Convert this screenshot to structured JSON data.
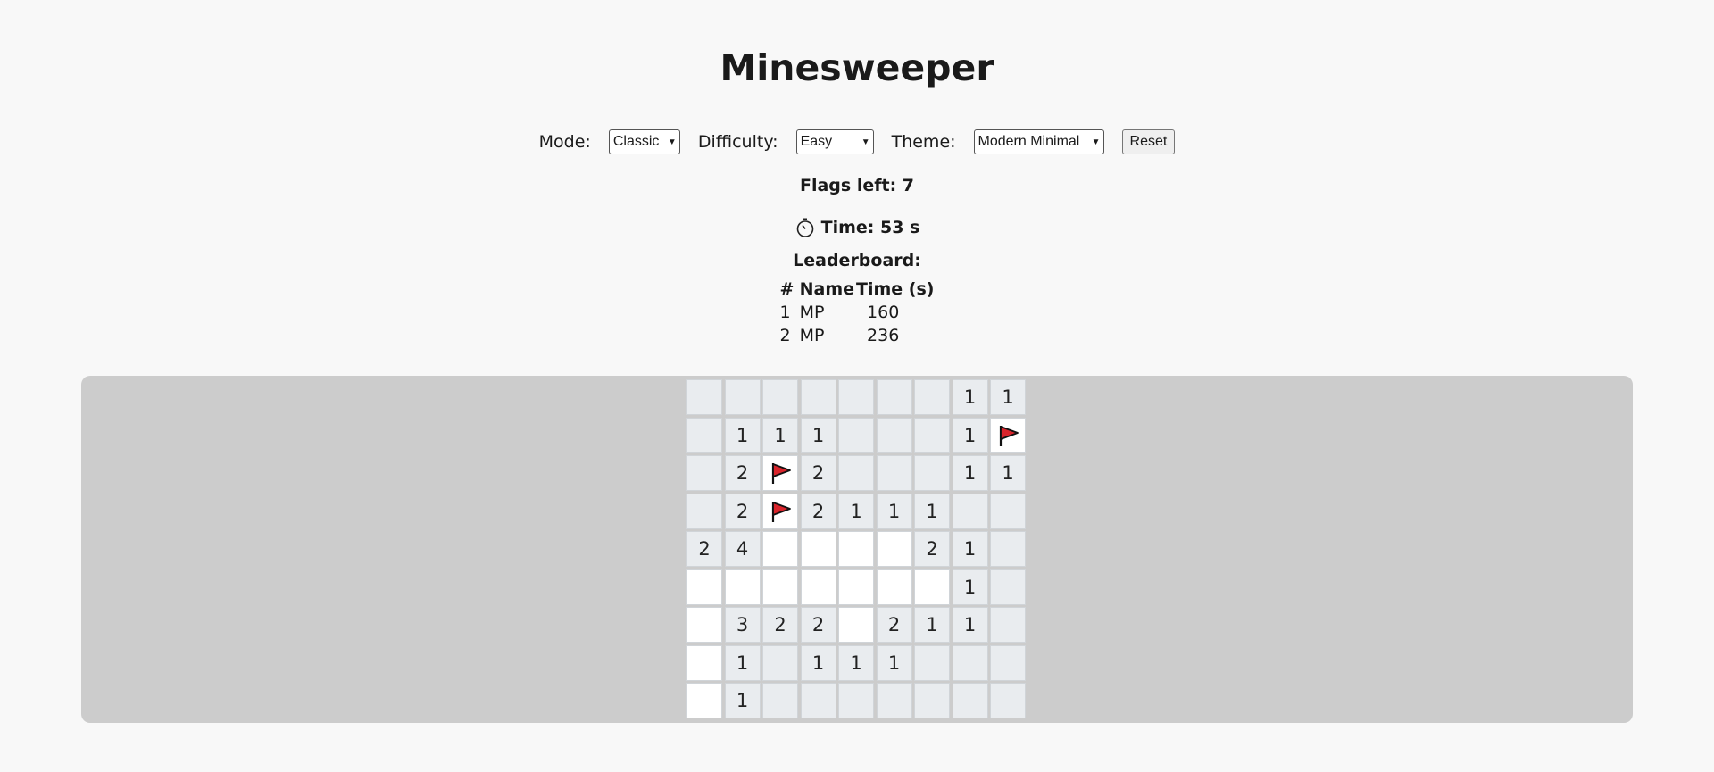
{
  "title": "Minesweeper",
  "controls": {
    "mode_label": "Mode:",
    "mode_value": "Classic",
    "difficulty_label": "Difficulty:",
    "difficulty_value": "Easy",
    "theme_label": "Theme:",
    "theme_value": "Modern Minimal",
    "reset_label": "Reset"
  },
  "status": {
    "flags_text": "Flags left: 7",
    "time_text": "Time: 53 s",
    "timer_icon": "stopwatch-icon"
  },
  "leaderboard": {
    "title": "Leaderboard:",
    "headers": [
      "#",
      "Name",
      "Time (s)"
    ],
    "rows": [
      [
        "1",
        "MP",
        "160"
      ],
      [
        "2",
        "MP",
        "236"
      ]
    ]
  },
  "board": {
    "colors": {
      "hidden": "#e9ecef",
      "revealed": "#ffffff",
      "board_bg": "#cccccc",
      "flag": "#d9242b"
    },
    "rows": [
      [
        "h",
        "h",
        "h",
        "h",
        "h",
        "h",
        "h",
        "1",
        "1"
      ],
      [
        "h",
        "1",
        "1",
        "1",
        "h",
        "h",
        "h",
        "1",
        "F"
      ],
      [
        "h",
        "2",
        "F",
        "2",
        "h",
        "h",
        "h",
        "1",
        "1"
      ],
      [
        "h",
        "2",
        "F",
        "2",
        "1",
        "1",
        "1",
        "h",
        "h"
      ],
      [
        "2",
        "4",
        "o",
        "o",
        "o",
        "o",
        "2",
        "1",
        "h"
      ],
      [
        "o",
        "o",
        "o",
        "o",
        "o",
        "o",
        "o",
        "1",
        "h"
      ],
      [
        "o",
        "3",
        "2",
        "2",
        "o",
        "2",
        "1",
        "1",
        "h"
      ],
      [
        "o",
        "1",
        "h",
        "1",
        "1",
        "1",
        "h",
        "h",
        "h"
      ],
      [
        "o",
        "1",
        "h",
        "h",
        "h",
        "h",
        "h",
        "h",
        "h"
      ]
    ]
  }
}
